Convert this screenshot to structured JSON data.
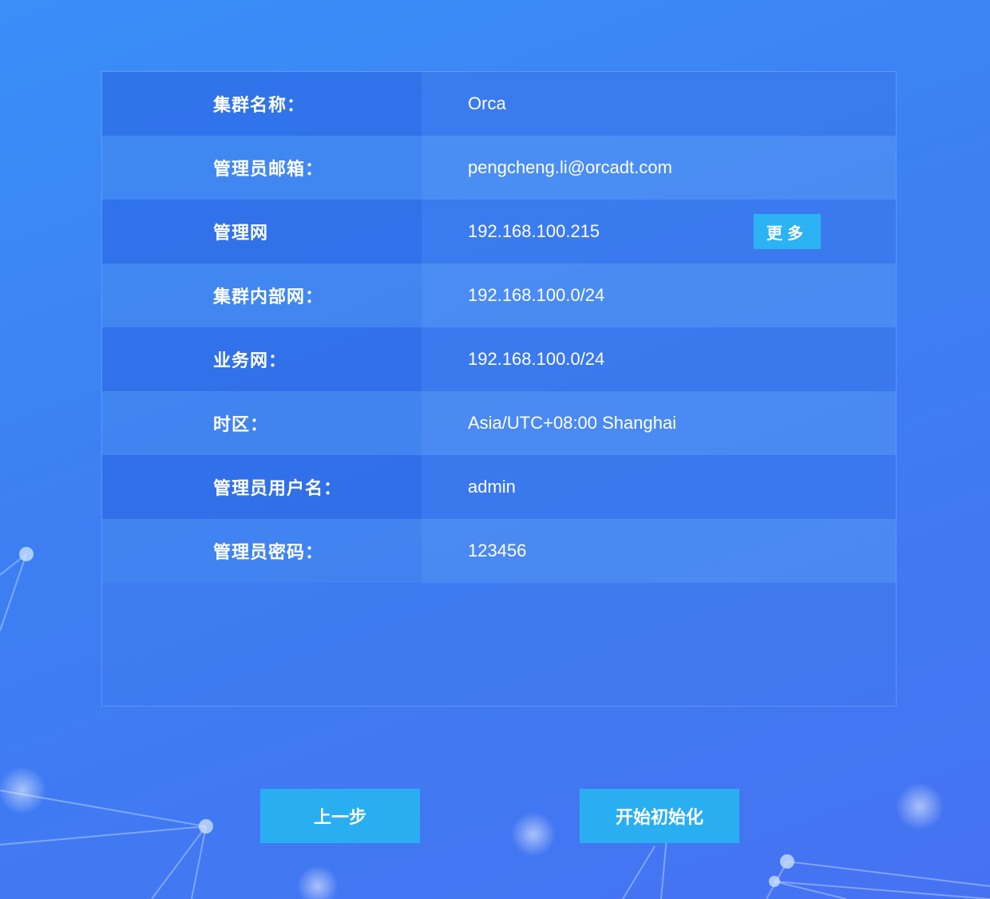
{
  "config": {
    "rows": [
      {
        "label": "集群名称：",
        "value": "Orca"
      },
      {
        "label": "管理员邮箱：",
        "value": "pengcheng.li@orcadt.com"
      },
      {
        "label": "管理网",
        "value": "192.168.100.215"
      },
      {
        "label": "集群内部网：",
        "value": "192.168.100.0/24"
      },
      {
        "label": "业务网：",
        "value": "192.168.100.0/24"
      },
      {
        "label": "时区：",
        "value": "Asia/UTC+08:00 Shanghai"
      },
      {
        "label": "管理员用户名：",
        "value": "admin"
      },
      {
        "label": "管理员密码：",
        "value": "123456"
      }
    ],
    "more_label": "更多"
  },
  "actions": {
    "prev_label": "上一步",
    "start_label": "开始初始化"
  },
  "colors": {
    "accent_button": "#2aaef2",
    "background_top": "#3a8ef8",
    "background_bottom": "#4672f2"
  }
}
